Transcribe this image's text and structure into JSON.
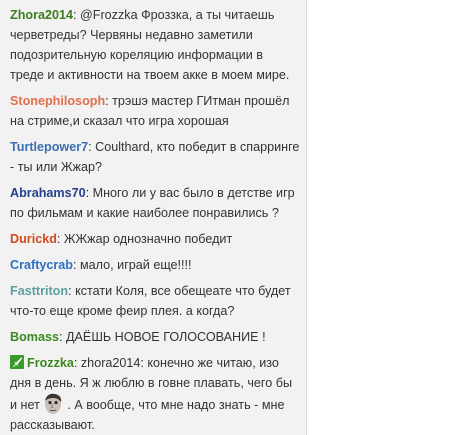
{
  "chat": {
    "messages": [
      {
        "nick": "Zhora2014",
        "nick_color": "#3b7d1f",
        "text": " @Frozzka Фроззка, а ты читаешь черветреды? Червяны недавно заметили подозрительную кореляцию информации в треде и активности на твоем акке в моем мире."
      },
      {
        "nick": "Stonephilosoph",
        "nick_color": "#e0704e",
        "text": " трэшэ мастер ГИтман прошёл на стриме,и сказал что игра хорошая"
      },
      {
        "nick": "Turtlepower7",
        "nick_color": "#3a6fb0",
        "text": " Coulthard, кто победит в спарринге - ты или Жжар?"
      },
      {
        "nick": "Abrahams70",
        "nick_color": "#27408b",
        "text": " Много ли у вас было в детстве игр по фильмам и какие наиболее понравились ?"
      },
      {
        "nick": "Durickd",
        "nick_color": "#d2491e",
        "text": " ЖЖжар однозначно победит"
      },
      {
        "nick": "Craftycrab",
        "nick_color": "#2e6fc4",
        "text": " мало, играй еще!!!!"
      },
      {
        "nick": "Fasttriton",
        "nick_color": "#5f9ea0",
        "text": " кстати Коля, все обещеате что будет что-то еще кроме феир плея. а когда?"
      },
      {
        "nick": "Bomass",
        "nick_color": "#3b8a1e",
        "text": " ДАЁШЬ НОВОЕ ГОЛОСОВАНИЕ !"
      },
      {
        "nick": "Frozzka",
        "nick_color": "#3b8a1e",
        "badge": "moderator-sword-icon",
        "text_before_emote": " zhora2014: конечно же читаю, изо дня в день. Я ж люблю в говне плавать, чего бы и нет",
        "emote": "kappa-face-emote",
        "text_after_emote": " . А вообще, что мне надо знать - мне рассказывают."
      }
    ],
    "separator": ":",
    "colors": {
      "background": "#f2f2f2",
      "text": "#333333",
      "moderator_badge": "#3a9a2a"
    }
  }
}
